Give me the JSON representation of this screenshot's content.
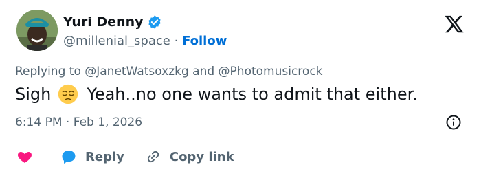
{
  "user": {
    "display_name": "Yuri Denny",
    "handle": "@millenial_space",
    "separator": "·",
    "follow_label": "Follow",
    "verified": true
  },
  "tweet": {
    "replying_prefix": "Replying to",
    "replying_to_1": "@JanetWatsoxzkg",
    "replying_and": "and",
    "replying_to_2": "@Photomusicrock",
    "text_before_emoji": "Sigh",
    "emoji": "pensive-face",
    "text_after_emoji": "Yeah..no one wants to admit that either.",
    "time": "6:14 PM",
    "date_separator": "·",
    "date": "Feb 1, 2026"
  },
  "actions": {
    "reply_label": "Reply",
    "copy_link_label": "Copy link"
  },
  "colors": {
    "accent": "#006fd6",
    "muted": "#536471",
    "heart": "#f91880",
    "reply_bubble": "#1d9bf0",
    "verified": "#1d9bf0"
  }
}
